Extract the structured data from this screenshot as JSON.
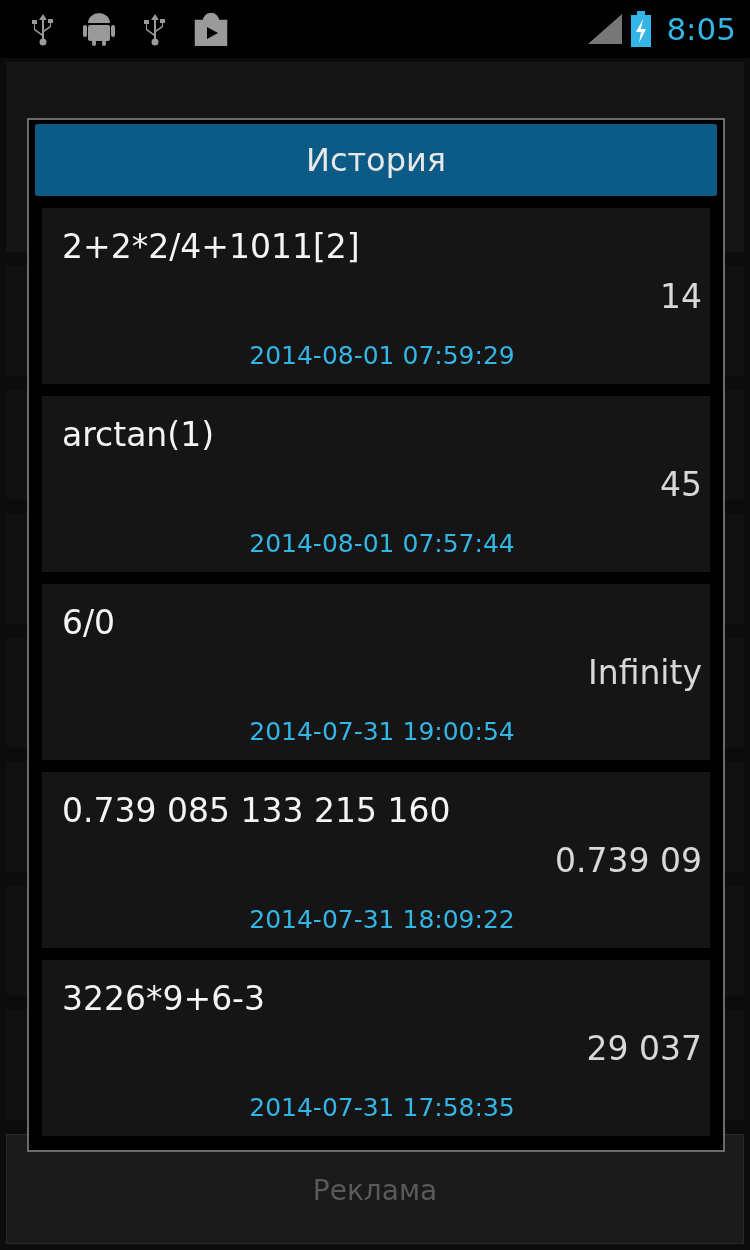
{
  "status_bar": {
    "time": "8:05"
  },
  "dialog": {
    "title": "История",
    "items": [
      {
        "expression": "2+2*2/4+1011[2]",
        "result": "14",
        "timestamp": "2014-08-01 07:59:29"
      },
      {
        "expression": "arctan(1)",
        "result": "45",
        "timestamp": "2014-08-01 07:57:44"
      },
      {
        "expression": "6/0",
        "result": "Infinity",
        "timestamp": "2014-07-31 19:00:54"
      },
      {
        "expression": "0.739 085 133 215 160",
        "result": "0.739 09",
        "timestamp": "2014-07-31 18:09:22"
      },
      {
        "expression": "3226*9+6-3",
        "result": "29 037",
        "timestamp": "2014-07-31 17:58:35"
      }
    ]
  },
  "ad_button": {
    "label": "Реклама"
  }
}
